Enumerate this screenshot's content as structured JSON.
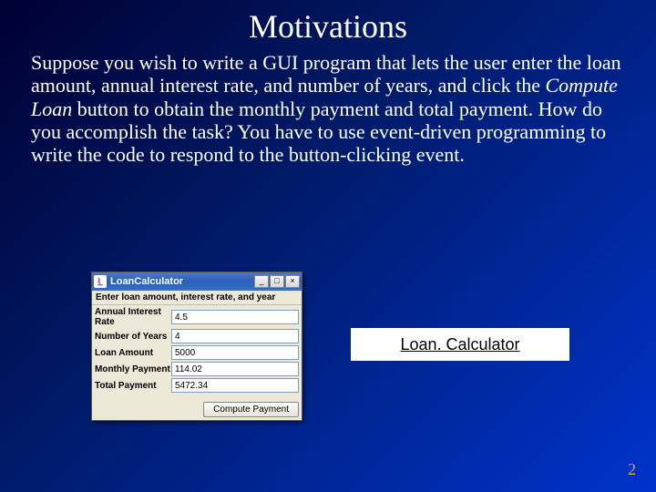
{
  "title": "Motivations",
  "body": {
    "pre": "Suppose you wish to write a GUI program that lets the user enter the loan amount, annual interest rate, and number of years, and click the ",
    "italic": "Compute Loan",
    "post": " button to obtain the monthly payment and total payment. How do you accomplish the task? You have to use event-driven programming to write the code to respond to the button-clicking event."
  },
  "window": {
    "title": "LoanCalculator",
    "instruction": "Enter loan amount, interest rate, and year",
    "minimize": "_",
    "maximize": "□",
    "close": "×",
    "fields": [
      {
        "label": "Annual Interest Rate",
        "value": "4.5"
      },
      {
        "label": "Number of Years",
        "value": "4"
      },
      {
        "label": "Loan Amount",
        "value": "5000"
      },
      {
        "label": "Monthly Payment",
        "value": "114.02"
      },
      {
        "label": "Total Payment",
        "value": "5472.34"
      }
    ],
    "button": "Compute Payment"
  },
  "link": "Loan. Calculator",
  "page_number": "2"
}
